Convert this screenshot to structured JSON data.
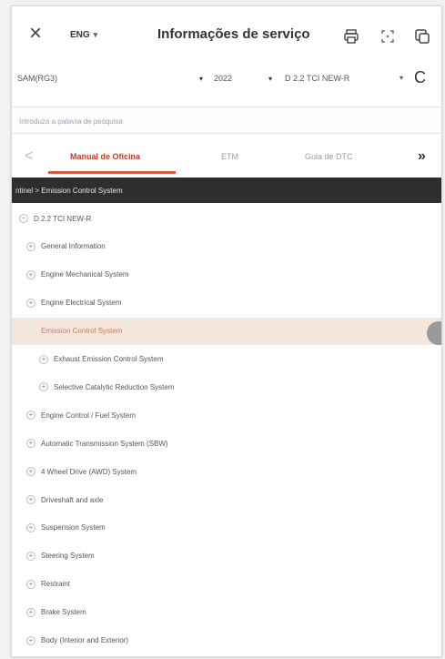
{
  "header": {
    "close": "×",
    "lang": "ENG",
    "lang_chevron": "▾",
    "title": "Informações de serviço"
  },
  "selectors": {
    "model": "SAM(RG3)",
    "year": "2022",
    "engine": "D 2.2 TCI NEW-R",
    "arrow": "▾",
    "refresh": "C"
  },
  "search": {
    "placeholder": "Introduza a palavra de pesquisa"
  },
  "tabs": [
    {
      "label": "Manual de Oficina",
      "active": true
    },
    {
      "label": "ETM",
      "active": false
    },
    {
      "label": "Guia de DTC",
      "active": false
    }
  ],
  "tab_arrows": {
    "left": "<",
    "right": "»"
  },
  "breadcrumb": "ntinel > Emission Control System",
  "tree": [
    {
      "label": "D 2.2 TCI NEW-R",
      "toggle": "−",
      "level": 0
    },
    {
      "label": "General Information",
      "toggle": "+",
      "level": 1
    },
    {
      "label": "Engine Mechanical System",
      "toggle": "+",
      "level": 1
    },
    {
      "label": "Engine Electrical System",
      "toggle": "+",
      "level": 1
    },
    {
      "label": "Emission Control System",
      "toggle": "",
      "level": 1,
      "selected": true
    },
    {
      "label": "Exhaust Emission Control System",
      "toggle": "+",
      "level": 2
    },
    {
      "label": "Selective Catalytic Reduction System",
      "toggle": "+",
      "level": 2
    },
    {
      "label": "Engine Control / Fuel System",
      "toggle": "+",
      "level": 1
    },
    {
      "label": "Automatic Transmission System (SBW)",
      "toggle": "+",
      "level": 1
    },
    {
      "label": "4 Wheel Drive (AWD) System",
      "toggle": "+",
      "level": 1
    },
    {
      "label": "Driveshaft and axle",
      "toggle": "+",
      "level": 1
    },
    {
      "label": "Suspension System",
      "toggle": "+",
      "level": 1
    },
    {
      "label": "Steering System",
      "toggle": "+",
      "level": 1
    },
    {
      "label": "Restraint",
      "toggle": "+",
      "level": 1
    },
    {
      "label": "Brake System",
      "toggle": "+",
      "level": 1
    },
    {
      "label": "Body (Interior and Exterior)",
      "toggle": "+",
      "level": 1
    }
  ],
  "colors": {
    "accent": "#d35a3f",
    "selected_bg": "#f5e6dc",
    "breadcrumb_bg": "#2e2e2e"
  }
}
